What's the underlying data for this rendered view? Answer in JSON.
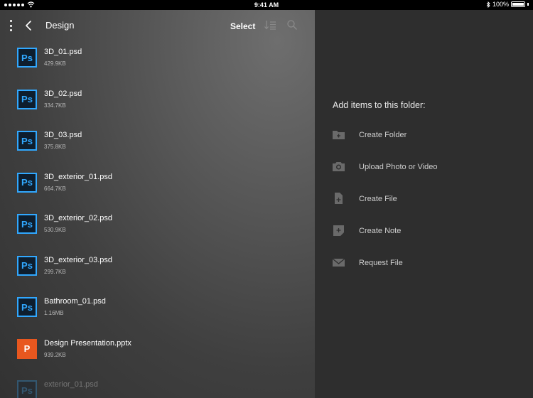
{
  "status_bar": {
    "time": "9:41 AM",
    "battery": "100%"
  },
  "header": {
    "title": "Design",
    "select_label": "Select"
  },
  "files": [
    {
      "name": "3D_01.psd",
      "size": "429.9KB",
      "type": "Ps"
    },
    {
      "name": "3D_02.psd",
      "size": "334.7KB",
      "type": "Ps"
    },
    {
      "name": "3D_03.psd",
      "size": "375.8KB",
      "type": "Ps"
    },
    {
      "name": "3D_exterior_01.psd",
      "size": "664.7KB",
      "type": "Ps"
    },
    {
      "name": "3D_exterior_02.psd",
      "size": "530.9KB",
      "type": "Ps"
    },
    {
      "name": "3D_exterior_03.psd",
      "size": "299.7KB",
      "type": "Ps"
    },
    {
      "name": "Bathroom_01.psd",
      "size": "1.16MB",
      "type": "Ps"
    },
    {
      "name": "Design Presentation.pptx",
      "size": "939.2KB",
      "type": "P"
    },
    {
      "name": "exterior_01.psd",
      "size": "",
      "type": "Ps"
    }
  ],
  "add_panel": {
    "title": "Add items to this folder:",
    "actions": [
      {
        "label": "Create Folder",
        "icon": "folder-add-icon"
      },
      {
        "label": "Upload Photo or Video",
        "icon": "camera-icon"
      },
      {
        "label": "Create File",
        "icon": "file-add-icon"
      },
      {
        "label": "Create Note",
        "icon": "note-add-icon"
      },
      {
        "label": "Request File",
        "icon": "envelope-icon"
      }
    ]
  },
  "colors": {
    "photoshop_blue": "#31a8ff",
    "powerpoint_orange": "#e8571f",
    "right_panel_bg": "#2e2e2e"
  }
}
